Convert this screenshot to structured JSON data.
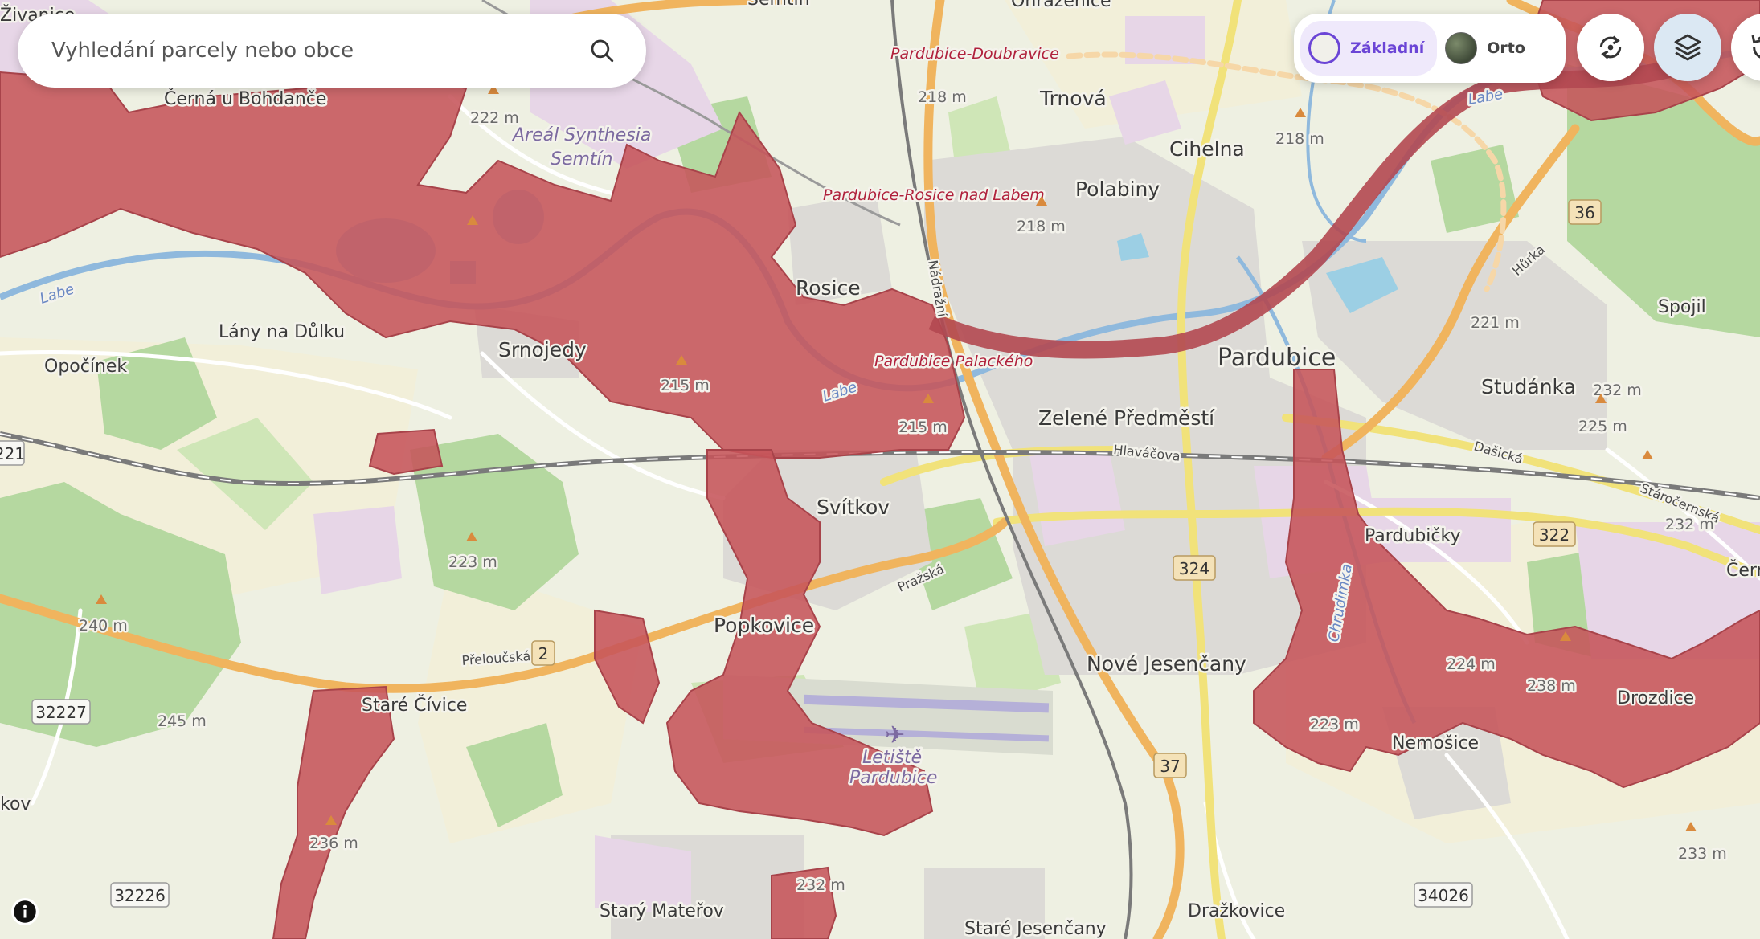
{
  "search": {
    "placeholder": "Vyhledání parcely nebo obce"
  },
  "basemap": {
    "options": [
      {
        "label": "Základní",
        "active": true
      },
      {
        "label": "Orto",
        "active": false
      }
    ]
  },
  "colors": {
    "flood": "#c6545a",
    "accent": "#6b45d6",
    "water": "#9ccfe4"
  },
  "map": {
    "places": {
      "pardubice": "Pardubice",
      "rosice": "Rosice",
      "srnojedy": "Srnojedy",
      "lany": "Lány na Důlku",
      "opocinek": "Opočínek",
      "svitkov": "Svítkov",
      "popkovice": "Popkovice",
      "stare_civice": "Staré Čívice",
      "novejesencany": "Nové Jesenčany",
      "nemosice": "Nemošice",
      "drozdice": "Drozdice",
      "studanka": "Studánka",
      "spojil": "Spojil",
      "pardubicky": "Pardubičky",
      "zelene": "Zelené Předměstí",
      "polabiny": "Polabiny",
      "cihelna": "Cihelna",
      "trnova": "Trnová",
      "cerna": "Černá u Bohdanče",
      "stary_materov": "Starý Mateřov",
      "stare_jesencany": "Staré Jesenčany",
      "drazkovice": "Dražkovice",
      "zivanice": "Živanice",
      "ohrazenice": "Ohrazenice",
      "semtin_top": "Semtín",
      "cern_partial": "Čern",
      "kov_partial": "kov",
      "semtin_areal_1": "Areál Synthesia",
      "semtin_areal_2": "Semtín",
      "airport_1": "Letiště",
      "airport_2": "Pardubice"
    },
    "stations": {
      "doubravice": "Pardubice-Doubravice",
      "rosice": "Pardubice-Rosice nad Labem",
      "palackeho": "Pardubice Palackého"
    },
    "rivers": {
      "labe1": "Labe",
      "labe2": "Labe",
      "labe3": "Labe",
      "chrudimka": "Chrudimka"
    },
    "streets": {
      "nadrazni": "Nádražní",
      "hlavacova": "Hlaváčova",
      "dasicka": "Dašická",
      "starocernska": "Stáročernská",
      "prazska": "Pražská",
      "preloucska": "Přeloučská",
      "hurka": "Hůrka"
    },
    "elevations": {
      "e1": "222 m",
      "e2": "218 m",
      "e3": "218 m",
      "e4": "218 m",
      "e5": "215 m",
      "e6": "215 m",
      "e7": "221 m",
      "e8": "232 m",
      "e9": "225 m",
      "e10": "232 m",
      "e11": "223 m",
      "e12": "240 m",
      "e13": "245 m",
      "e14": "236 m",
      "e15": "232 m",
      "e16": "223 m",
      "e17": "224 m",
      "e18": "238 m",
      "e19": "233 m"
    },
    "roads": {
      "r36": "36",
      "r322": "322",
      "r324": "324",
      "r2": "2",
      "r37": "37",
      "r32227": "32227",
      "r32226": "32226",
      "r34026": "34026",
      "r221": "221"
    }
  }
}
